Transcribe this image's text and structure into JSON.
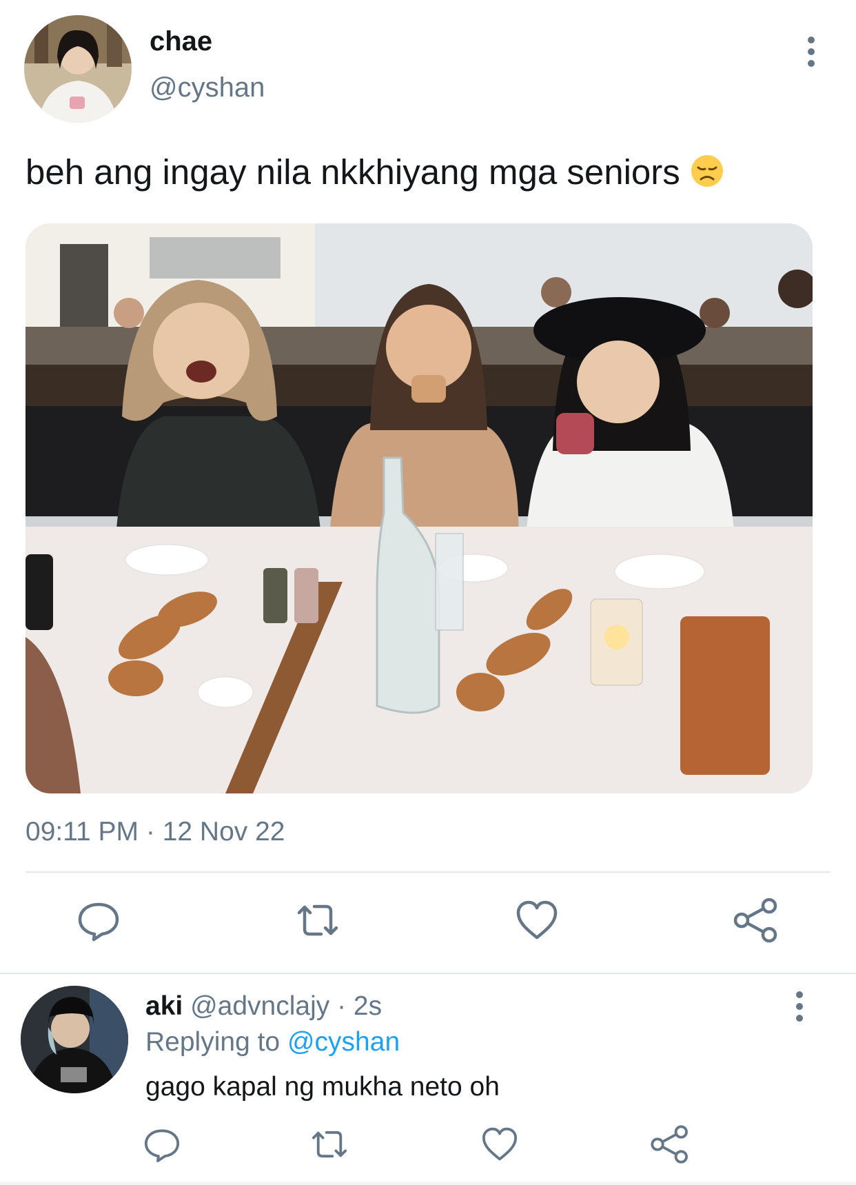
{
  "tweet": {
    "display_name": "chae",
    "handle": "@cyshan",
    "text": "beh ang ingay nila nkkhiyang mga seniors",
    "emoji": "disappointed-face",
    "timestamp": "09:11 PM · 12 Nov 22",
    "actions": [
      "reply",
      "retweet",
      "like",
      "share"
    ]
  },
  "reply": {
    "display_name": "aki",
    "handle": "@advnclajy",
    "time": "· 2s",
    "replying_label": "Replying to",
    "replying_handle": "@cyshan",
    "text": "gago kapal ng mukha neto oh",
    "actions": [
      "reply",
      "retweet",
      "like",
      "share"
    ]
  },
  "colors": {
    "text": "#14171a",
    "secondary": "#657786",
    "link": "#1da1f2",
    "divider": "#e1e8ed"
  }
}
